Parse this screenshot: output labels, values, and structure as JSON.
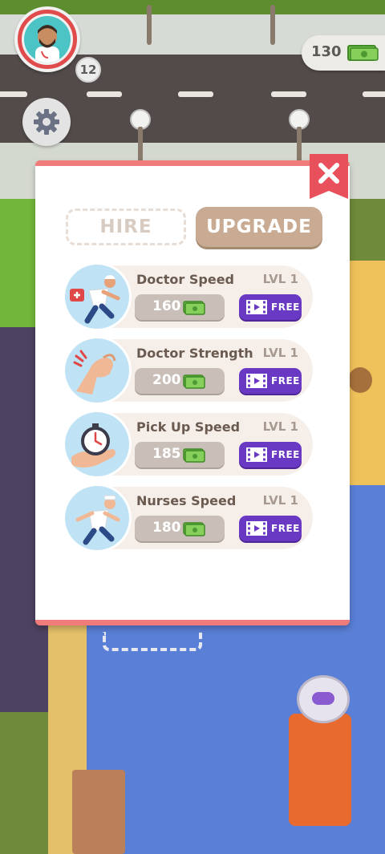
{
  "hud": {
    "player_level": "12",
    "cash_amount": "130"
  },
  "modal": {
    "tabs": {
      "hire": "HIRE",
      "upgrade": "UPGRADE"
    },
    "active_tab": "upgrade",
    "upgrades": [
      {
        "title": "Doctor Speed",
        "level": "LVL 1",
        "price": "160",
        "free_label": "FREE",
        "icon": "running-doctor-icon"
      },
      {
        "title": "Doctor Strength",
        "level": "LVL 1",
        "price": "200",
        "free_label": "FREE",
        "icon": "flexing-arm-icon"
      },
      {
        "title": "Pick Up Speed",
        "level": "LVL 1",
        "price": "185",
        "free_label": "FREE",
        "icon": "stopwatch-icon"
      },
      {
        "title": "Nurses Speed",
        "level": "LVL 1",
        "price": "180",
        "free_label": "FREE",
        "icon": "running-nurse-icon"
      }
    ]
  },
  "colors": {
    "modal_accent": "#ef7b7b",
    "upgrade_tab": "#c8ab92",
    "free_button": "#6a39c4",
    "price_button": "#c9bfb8"
  }
}
